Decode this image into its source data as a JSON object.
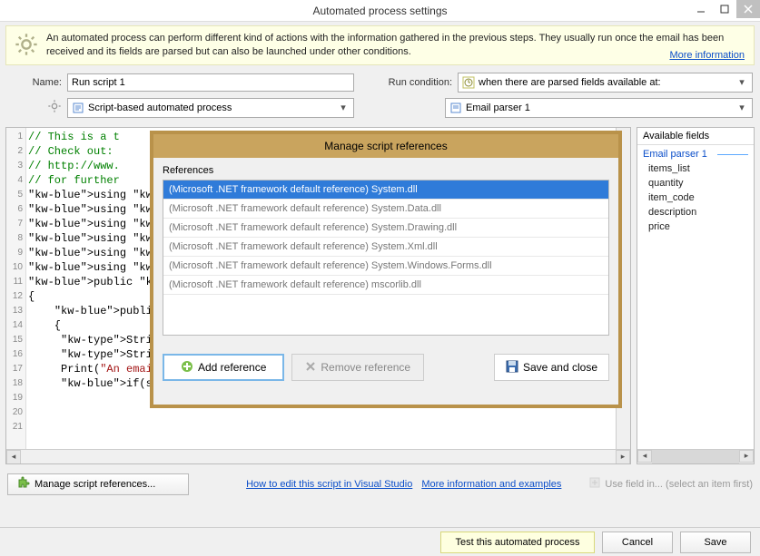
{
  "window": {
    "title": "Automated process settings"
  },
  "banner": {
    "text": "An automated process can perform different kind of actions with the information gathered in the previous steps. They usually run once the email has been received and its fields are parsed but can also be launched under other conditions.",
    "more": "More information"
  },
  "form": {
    "name_label": "Name:",
    "name_value": "Run script 1",
    "runcond_label": "Run condition:",
    "runcond_value": "when there are parsed fields available at:",
    "process_type": "Script-based automated process",
    "parser": "Email parser 1"
  },
  "code": {
    "lines": [
      "// This is a t",
      "// Check out:",
      "// http://www.",
      "// for further",
      "",
      "using System;",
      "using System.T",
      "using System.I",
      "using System.N",
      "using System.C",
      "using EmailAnd",
      "",
      "public class M",
      "{",
      "    public ove",
      "    {",
      "     String mes",
      "     String sen",
      "     Print(\"An email has been sent from \"+sender_address+\" and the subject is",
      "",
      "     if(sender_address.Equals(\"john@doe.com\"))"
    ]
  },
  "fields": {
    "title": "Available fields",
    "group": "Email parser 1",
    "items": [
      "items_list",
      "quantity",
      "item_code",
      "description",
      "price"
    ]
  },
  "under": {
    "manage": "Manage script references...",
    "howto": "How to edit this script in Visual Studio",
    "moreinfo": "More information and examples",
    "usefield": "Use field in... (select an item first)"
  },
  "footer": {
    "test": "Test this automated process",
    "cancel": "Cancel",
    "save": "Save"
  },
  "dialog": {
    "title": "Manage script references",
    "label": "References",
    "items": [
      "(Microsoft .NET framework default reference) System.dll",
      "(Microsoft .NET framework default reference) System.Data.dll",
      "(Microsoft .NET framework default reference) System.Drawing.dll",
      "(Microsoft .NET framework default reference) System.Xml.dll",
      "(Microsoft .NET framework default reference) System.Windows.Forms.dll",
      "(Microsoft .NET framework default reference) mscorlib.dll"
    ],
    "add": "Add reference",
    "remove": "Remove reference",
    "save": "Save and close"
  }
}
